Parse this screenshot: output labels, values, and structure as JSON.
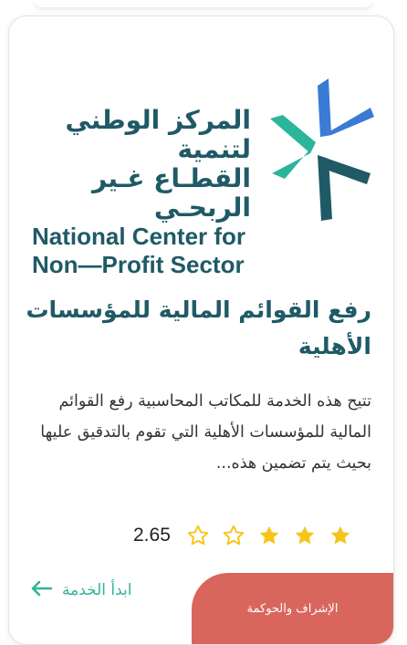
{
  "card": {
    "logo": {
      "ar_line1": "المركز الوطني لتنمية",
      "ar_line2": "القطـاع غـير الربحـي",
      "en_line1": "National Center for",
      "en_line2": "Non—Profit Sector",
      "colors": {
        "teal": "#2bb59a",
        "blue": "#3a7bd5",
        "dark": "#1f5a66"
      }
    },
    "title": "رفع القوائم المالية للمؤسسات الأهلية",
    "description": "تتيح هذه الخدمة للمكاتب المحاسبية رفع القوائم المالية للمؤسسات الأهلية التي تقوم بالتدقيق عليها بحيث يتم تضمين هذه...",
    "rating": {
      "value": "2.65",
      "filled_stars": 3,
      "max_stars": 5,
      "filled_color": "#f5c518",
      "empty_color": "#f5c518"
    },
    "start_label": "ابدأ الخدمة",
    "start_icon": "arrow-left-icon",
    "category_tag": "الإشراف والحوكمة",
    "tag_color": "#d8665d",
    "accent": "#35b39a"
  }
}
